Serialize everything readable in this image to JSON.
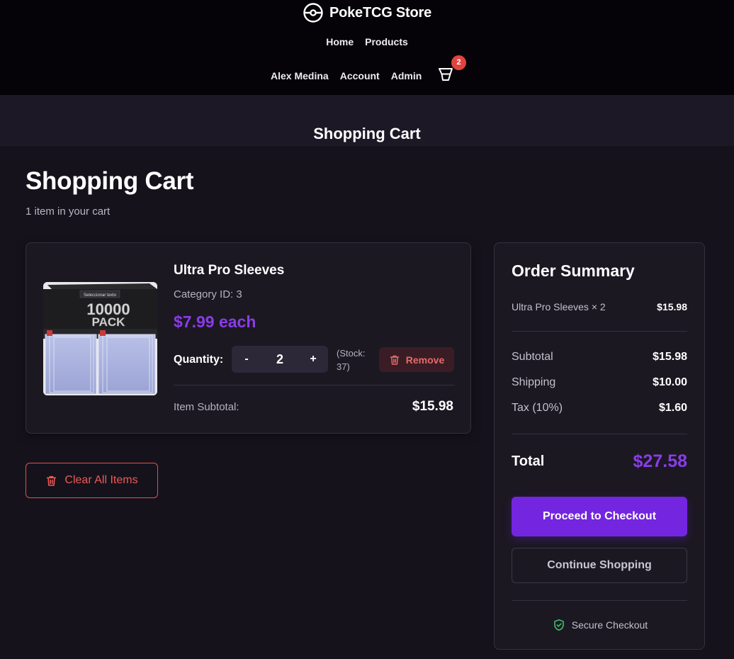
{
  "header": {
    "brand": "PokeTCG Store",
    "nav_primary": [
      "Home",
      "Products"
    ],
    "nav_secondary": [
      "Alex Medina",
      "Account",
      "Admin"
    ],
    "cart_count": "2"
  },
  "hero": {
    "title": "Shopping Cart"
  },
  "page": {
    "title": "Shopping Cart",
    "subtitle": "1 item in your cart"
  },
  "cart_item": {
    "name": "Ultra Pro Sleeves",
    "category": "Category ID: 3",
    "price": "$7.99 each",
    "quantity_label": "Quantity:",
    "decrement": "-",
    "quantity": "2",
    "increment": "+",
    "stock": "(Stock: 37)",
    "remove_label": "Remove",
    "subtotal_label": "Item Subtotal:",
    "subtotal_value": "$15.98",
    "image": {
      "top_text": "Seleccionar texto",
      "big_text_1": "10000",
      "big_text_2": "PACK"
    }
  },
  "clear_all_label": "Clear All Items",
  "summary": {
    "title": "Order Summary",
    "line_item": "Ultra Pro Sleeves × 2",
    "line_value": "$15.98",
    "subtotal_label": "Subtotal",
    "subtotal_value": "$15.98",
    "shipping_label": "Shipping",
    "shipping_value": "$10.00",
    "tax_label": "Tax (10%)",
    "tax_value": "$1.60",
    "total_label": "Total",
    "total_value": "$27.58",
    "checkout_label": "Proceed to Checkout",
    "continue_label": "Continue Shopping",
    "secure_label": "Secure Checkout"
  },
  "colors": {
    "accent": "#7425e0",
    "price": "#8a3ce8",
    "danger": "#e0524d",
    "secure": "#3fbf6a"
  },
  "icons": [
    "pokeball-logo-icon",
    "cart-icon",
    "trash-icon",
    "shield-check-icon"
  ]
}
